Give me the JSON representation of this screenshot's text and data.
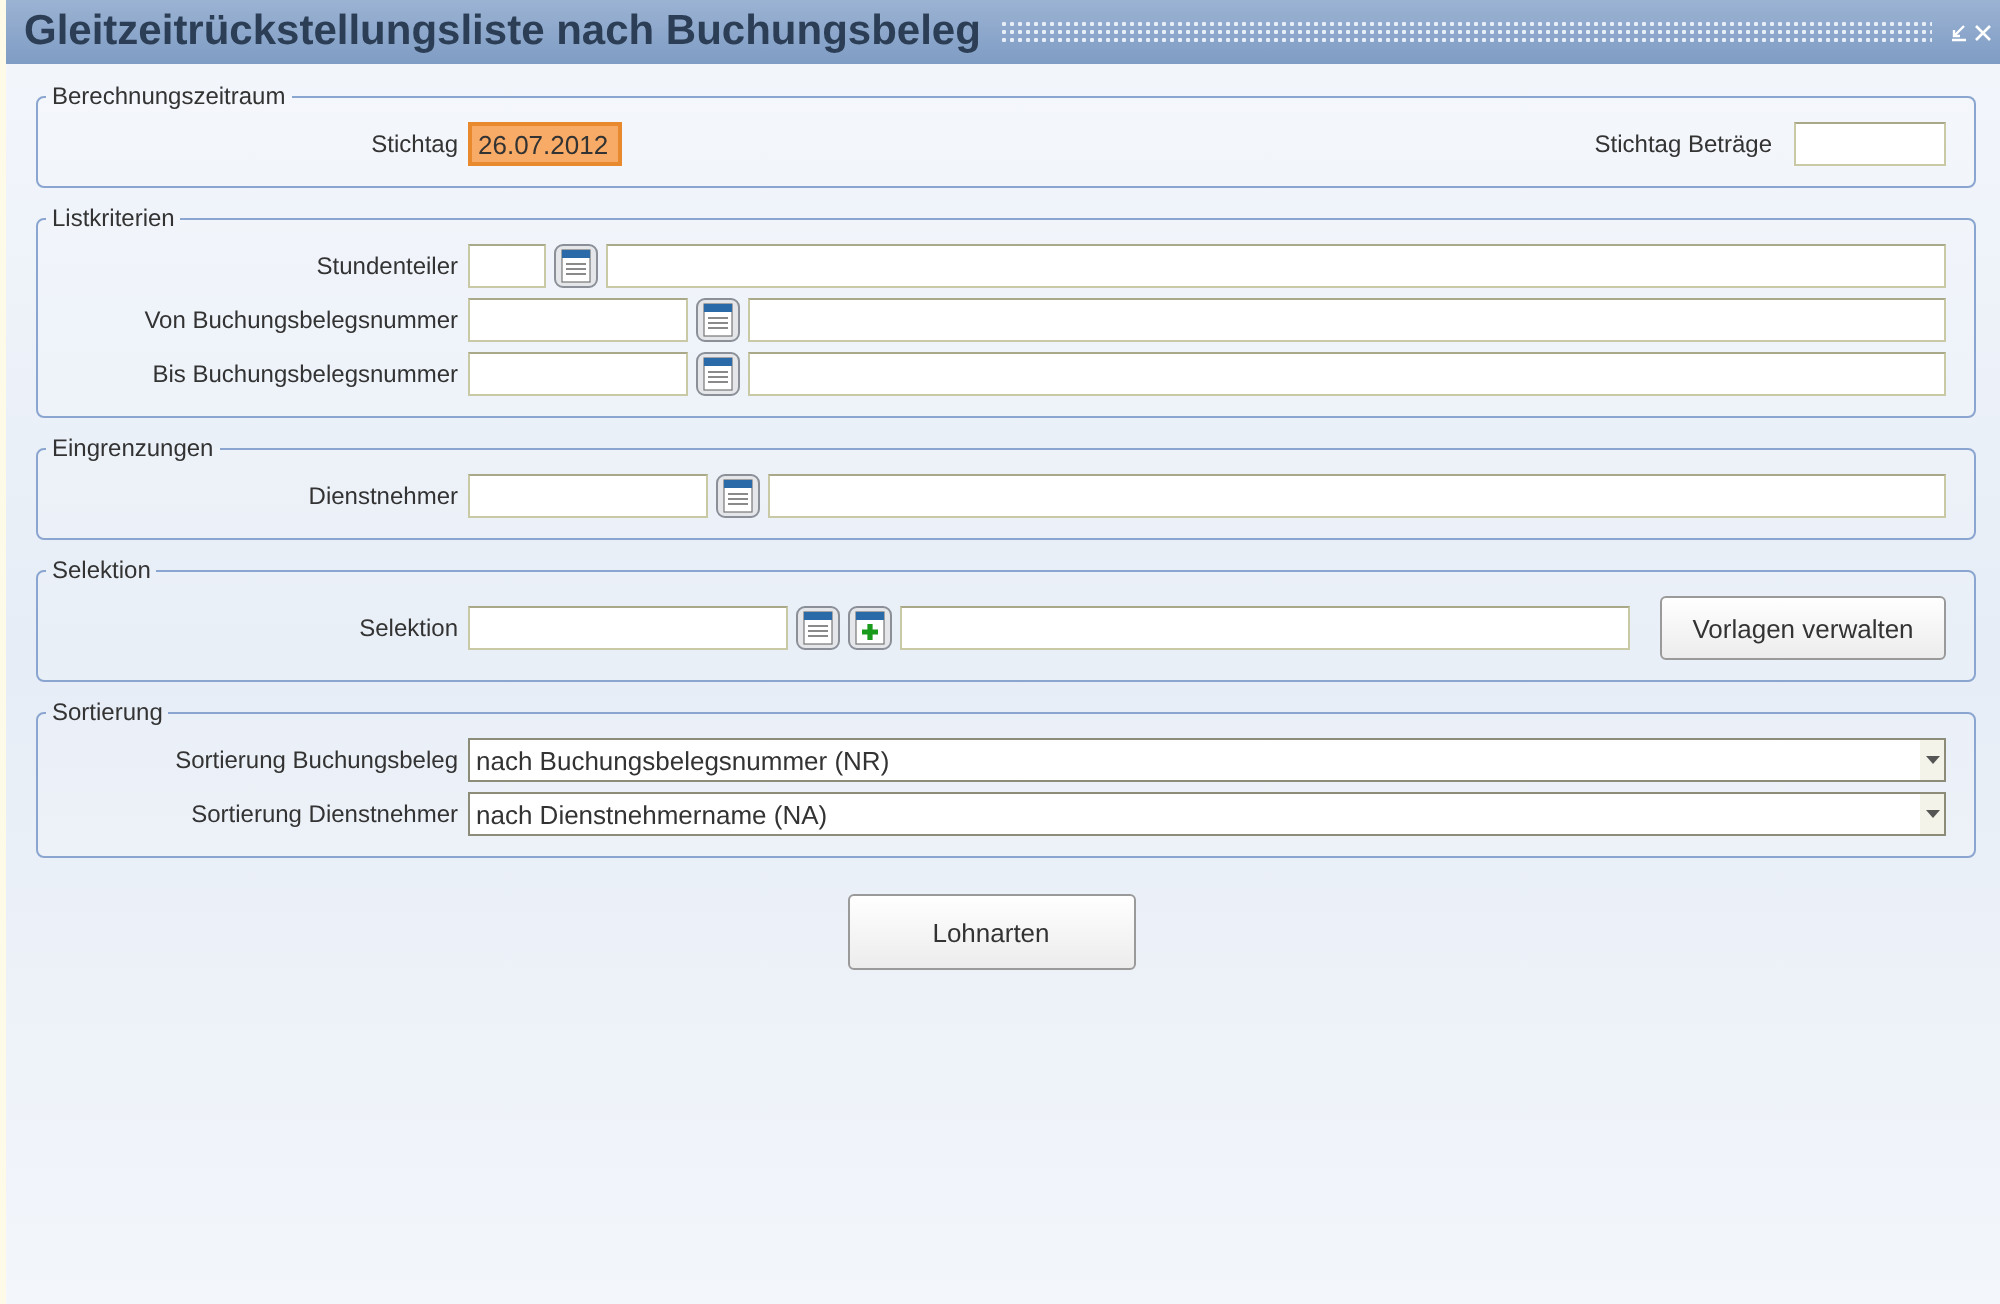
{
  "window": {
    "title": "Gleitzeitrückstellungsliste nach Buchungsbeleg"
  },
  "sections": [
    {
      "legend": "Berechnungszeitraum",
      "rows": [
        {
          "kind": "date-pair",
          "left": {
            "label": "Stichtag",
            "value": "26.07.2012",
            "focused": true
          },
          "right": {
            "label": "Stichtag Beträge",
            "focused": false
          }
        }
      ]
    },
    {
      "legend": "Listkriterien",
      "rows": [
        {
          "kind": "lookup",
          "label": "Stundenteiler"
        },
        {
          "kind": "lookup",
          "label": "Von Buchungsbelegsnummer"
        },
        {
          "kind": "lookup",
          "label": "Bis Buchungsbelegsnummer"
        }
      ]
    },
    {
      "legend": "Eingrenzungen",
      "rows": [
        {
          "kind": "lookup",
          "label": "Dienstnehmer"
        }
      ]
    },
    {
      "legend": "Selektion",
      "rows": [
        {
          "kind": "lookup-add",
          "label": "Selektion",
          "button": "Vorlagen verwalten"
        }
      ]
    },
    {
      "legend": "Sortierung",
      "rows": [
        {
          "kind": "select",
          "label": "Sortierung Buchungsbeleg",
          "value": "nach Buchungsbelegsnummer (NR)"
        },
        {
          "kind": "select",
          "label": "Sortierung Dienstnehmer",
          "value": "nach Dienstnehmername (NA)"
        }
      ]
    }
  ],
  "buttons": [
    {
      "label": "Lohnarten"
    }
  ]
}
